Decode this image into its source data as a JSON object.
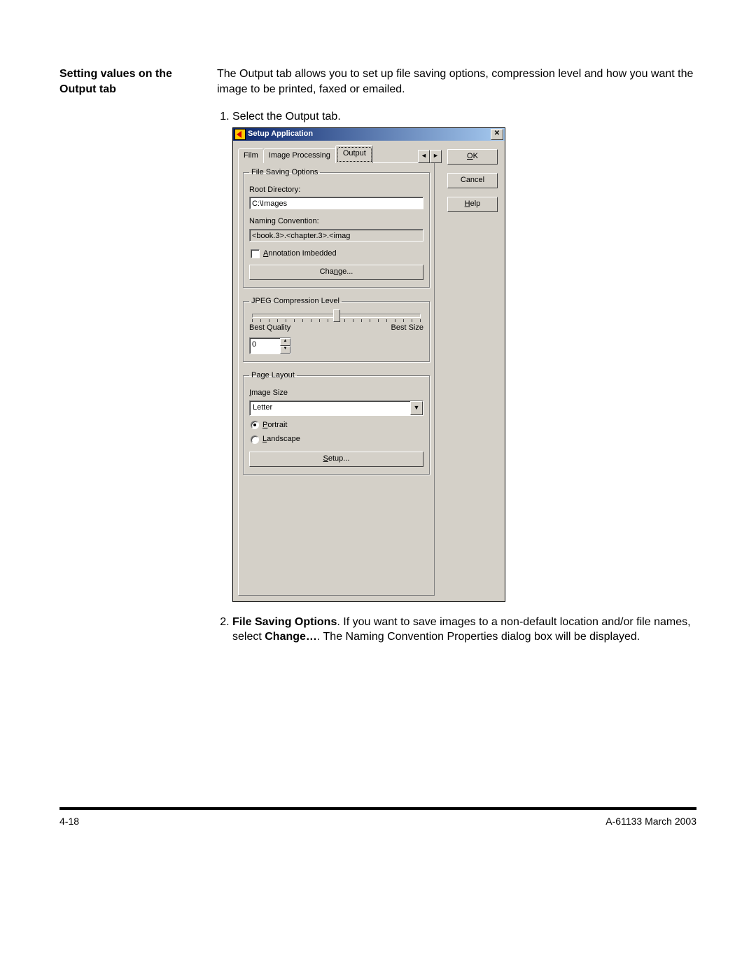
{
  "doc": {
    "side_heading": "Setting values on the Output tab",
    "intro": "The Output tab allows you to set up file saving options, compression level and how you want the image to be printed, faxed or emailed.",
    "step1": "Select the Output tab.",
    "step2_bold": "File Saving Options",
    "step2_rest1": ". If you want to save images to a non-default location and/or file names, select ",
    "step2_bold2": "Change…",
    "step2_rest2": ". The Naming Convention Properties dialog box will be displayed.",
    "page_number": "4-18",
    "doc_id": "A-61133  March 2003"
  },
  "dialog": {
    "title": "Setup Application",
    "close_glyph": "✕",
    "tabs": {
      "film": "Film",
      "image_processing": "Image Processing",
      "output": "Output"
    },
    "scroll_left": "◄",
    "scroll_right": "►",
    "file_saving": {
      "legend": "File Saving Options",
      "root_dir_label": "Root Directory:",
      "root_dir_value": "C:\\Images",
      "naming_label": "Naming Convention:",
      "naming_value": "<book.3>.<chapter.3>.<imag",
      "annotation_label_u": "A",
      "annotation_label_rest": "nnotation Imbedded",
      "change_btn_pre": "Cha",
      "change_btn_u": "n",
      "change_btn_post": "ge..."
    },
    "jpeg": {
      "legend": "JPEG Compression Level",
      "best_quality": "Best Quality",
      "best_size": "Best Size",
      "value": "0",
      "up": "▲",
      "down": "▼"
    },
    "page_layout": {
      "legend": "Page Layout",
      "image_size_u": "I",
      "image_size_rest": "mage Size",
      "image_size_value": "Letter",
      "dropdown_glyph": "▼",
      "portrait_u": "P",
      "portrait_rest": "ortrait",
      "landscape_u": "L",
      "landscape_rest": "andscape",
      "setup_u": "S",
      "setup_rest": "etup..."
    },
    "buttons": {
      "ok_u": "O",
      "ok_rest": "K",
      "cancel": "Cancel",
      "help_u": "H",
      "help_rest": "elp"
    }
  }
}
